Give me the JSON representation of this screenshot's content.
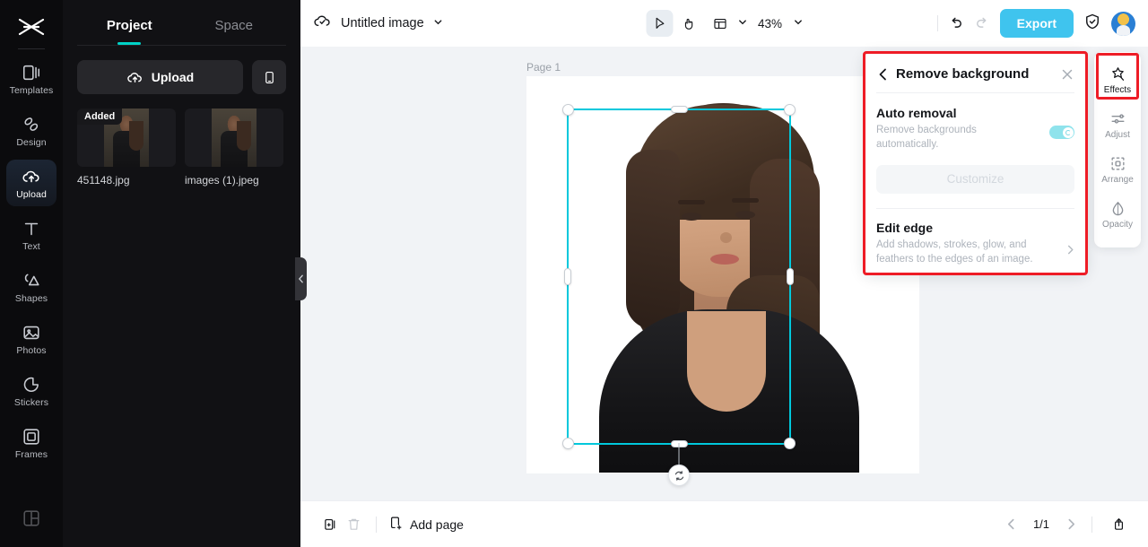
{
  "left_rail": {
    "logo": "capcut-logo-icon",
    "items": [
      {
        "label": "Templates",
        "icon": "templates-icon",
        "active": false
      },
      {
        "label": "Design",
        "icon": "design-icon",
        "active": false
      },
      {
        "label": "Upload",
        "icon": "upload-cloud-icon",
        "active": true
      },
      {
        "label": "Text",
        "icon": "text-icon",
        "active": false
      },
      {
        "label": "Shapes",
        "icon": "shapes-icon",
        "active": false
      },
      {
        "label": "Photos",
        "icon": "photos-icon",
        "active": false
      },
      {
        "label": "Stickers",
        "icon": "stickers-icon",
        "active": false
      },
      {
        "label": "Frames",
        "icon": "frames-icon",
        "active": false
      }
    ],
    "bottom_icon": "layout-grid-icon"
  },
  "panel": {
    "tabs": [
      {
        "label": "Project",
        "active": true
      },
      {
        "label": "Space",
        "active": false
      }
    ],
    "upload_label": "Upload",
    "upload_icon": "upload-cloud-icon",
    "mobile_icon": "mobile-phone-icon",
    "files": [
      {
        "name": "451148.jpg",
        "badge": "Added"
      },
      {
        "name": "images (1).jpeg",
        "badge": ""
      }
    ],
    "accent": "#00d2c7"
  },
  "topbar": {
    "cloud_icon": "cloud-check-icon",
    "doc_title": "Untitled image",
    "title_chevron": "chevron-down-icon",
    "tools": [
      {
        "name": "select-cursor-icon",
        "selected": true
      },
      {
        "name": "hand-pan-icon",
        "selected": false
      },
      {
        "name": "layout-panel-icon",
        "selected": false
      }
    ],
    "zoom_value": "43%",
    "undo_icon": "undo-icon",
    "redo_icon": "redo-icon",
    "export_label": "Export",
    "export_color": "#3fc4ee",
    "shield_icon": "shield-check-icon",
    "avatar": "user-avatar"
  },
  "canvas": {
    "page_label": "Page 1",
    "background": "#f1f3f6",
    "selection_color": "#00c8dc",
    "object_toolbar": [
      "crop-icon",
      "remove-background-icon",
      "duplicate-icon",
      "more-options-icon"
    ],
    "rotate_icon": "rotate-icon"
  },
  "effects_panel": {
    "back_icon": "chevron-left-icon",
    "title": "Remove background",
    "close_icon": "close-icon",
    "auto_removal": {
      "title": "Auto removal",
      "description": "Remove backgrounds automatically.",
      "toggle_on": true,
      "toggle_color": "#8fe3ec"
    },
    "customize_label": "Customize",
    "customize_disabled": true,
    "edit_edge": {
      "title": "Edit edge",
      "description": "Add shadows, strokes, glow, and feathers to the edges of an image.",
      "arrow_icon": "chevron-right-icon"
    },
    "highlight_color": "#ee1c26"
  },
  "right_rail": {
    "items": [
      {
        "label": "Effects",
        "icon": "effects-star-icon",
        "active": true
      },
      {
        "label": "Adjust",
        "icon": "adjust-sliders-icon",
        "active": false
      },
      {
        "label": "Arrange",
        "icon": "arrange-icon",
        "active": false
      },
      {
        "label": "Opacity",
        "icon": "opacity-drop-icon",
        "active": false
      }
    ],
    "highlight_color": "#ee1c26"
  },
  "bottombar": {
    "duplicate_page_icon": "duplicate-page-icon",
    "delete_page_icon": "trash-icon",
    "add_page_icon": "add-page-icon",
    "add_page_label": "Add page",
    "prev_icon": "chevron-left-icon",
    "page_indicator": "1/1",
    "next_icon": "chevron-right-icon",
    "export_page_icon": "export-page-icon"
  }
}
